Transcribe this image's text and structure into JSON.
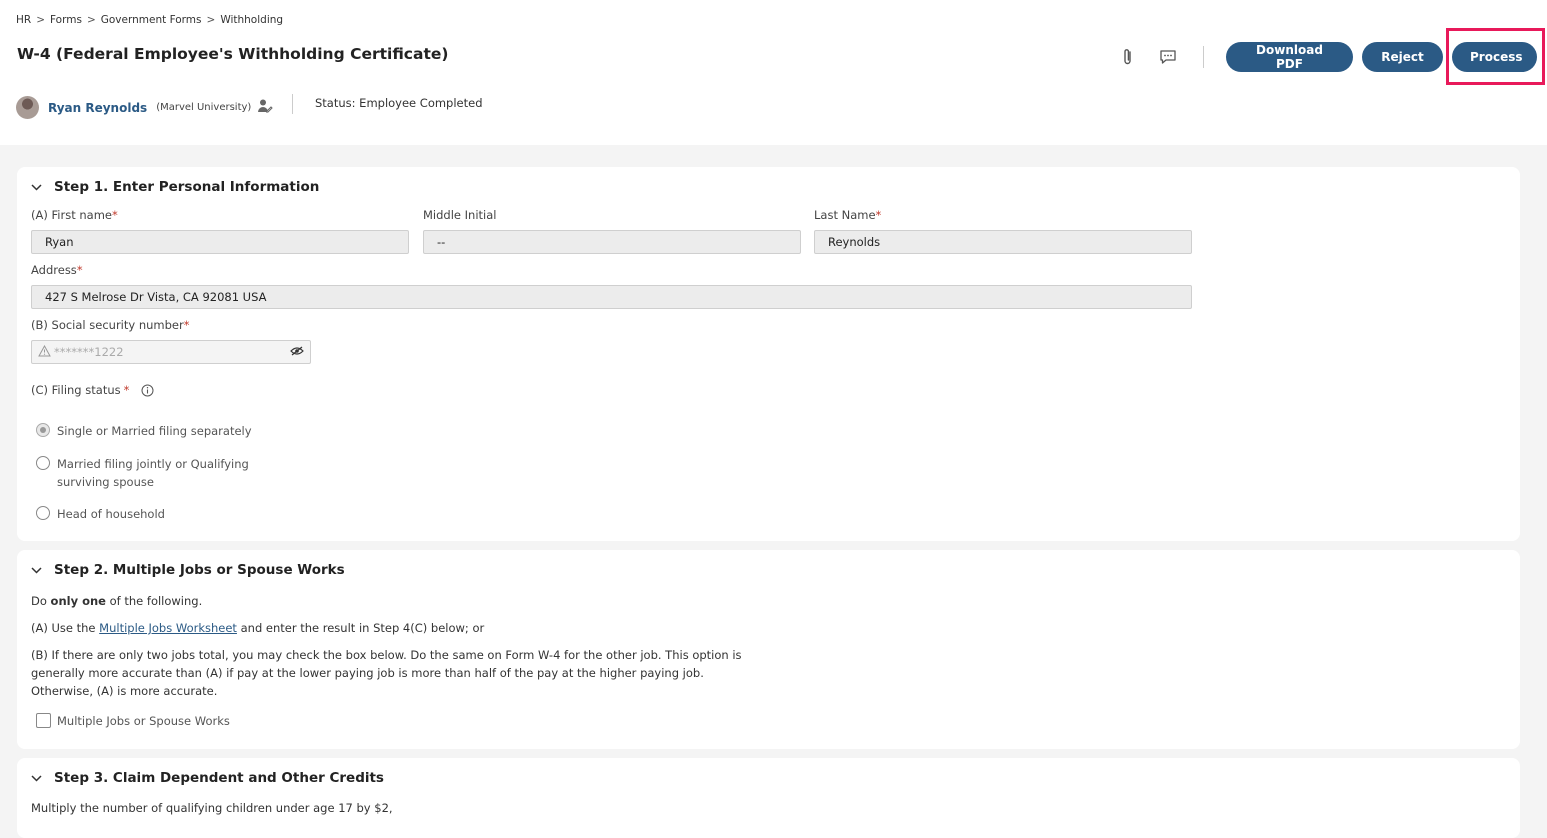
{
  "breadcrumb": [
    "HR",
    "Forms",
    "Government Forms",
    "Withholding"
  ],
  "breadcrumb_sep": ">",
  "title": "W-4 (Federal Employee's Withholding Certificate)",
  "toolbar": {
    "attachment_icon": "paperclip-icon",
    "comment_icon": "comment-icon",
    "download_label": "Download PDF",
    "reject_label": "Reject",
    "process_label": "Process"
  },
  "user": {
    "name": "Ryan Reynolds",
    "org": "(Marvel University)",
    "status": "Status: Employee Completed"
  },
  "step1": {
    "title": "Step 1. Enter Personal Information",
    "first_name_label": "(A) First name",
    "first_name": "Ryan",
    "middle_initial_label": "Middle Initial",
    "middle_initial": "--",
    "last_name_label": "Last Name",
    "last_name": "Reynolds",
    "address_label": "Address",
    "address": "427 S Melrose Dr Vista, CA 92081 USA",
    "ssn_label": "(B) Social security number",
    "ssn": "*******1222",
    "filing_status_label": "(C) Filing status",
    "filing_options": [
      {
        "label": "Single or Married filing separately",
        "checked": true
      },
      {
        "label": "Married filing jointly or Qualifying surviving spouse",
        "checked": false
      },
      {
        "label": "Head of household",
        "checked": false
      }
    ],
    "married_line1": "Married filing jointly or Qualifying",
    "married_line2": "surviving spouse"
  },
  "step2": {
    "title": "Step 2. Multiple Jobs or Spouse Works",
    "do_prefix": "Do ",
    "do_bold": "only one",
    "do_suffix": " of the following.",
    "a_prefix": "(A) Use the ",
    "a_link": "Multiple Jobs Worksheet",
    "a_suffix": " and enter the result in Step 4(C) below; or",
    "b_line1": "(B) If there are only two jobs total, you may check the box below. Do the same on Form W-4 for the other job. This option is",
    "b_line2": "generally more accurate than (A) if pay at the lower paying job is more than half of the pay at the higher paying job.",
    "b_line3": "Otherwise, (A) is more accurate.",
    "checkbox_label": "Multiple Jobs or Spouse Works"
  },
  "step3": {
    "title": "Step 3. Claim Dependent and Other Credits",
    "line1": "Multiply the number of qualifying children under age 17 by $2,"
  },
  "required_mark": "*",
  "colors": {
    "primary": "#2b5a85",
    "highlight": "#e8195a",
    "required": "#c0392b"
  }
}
